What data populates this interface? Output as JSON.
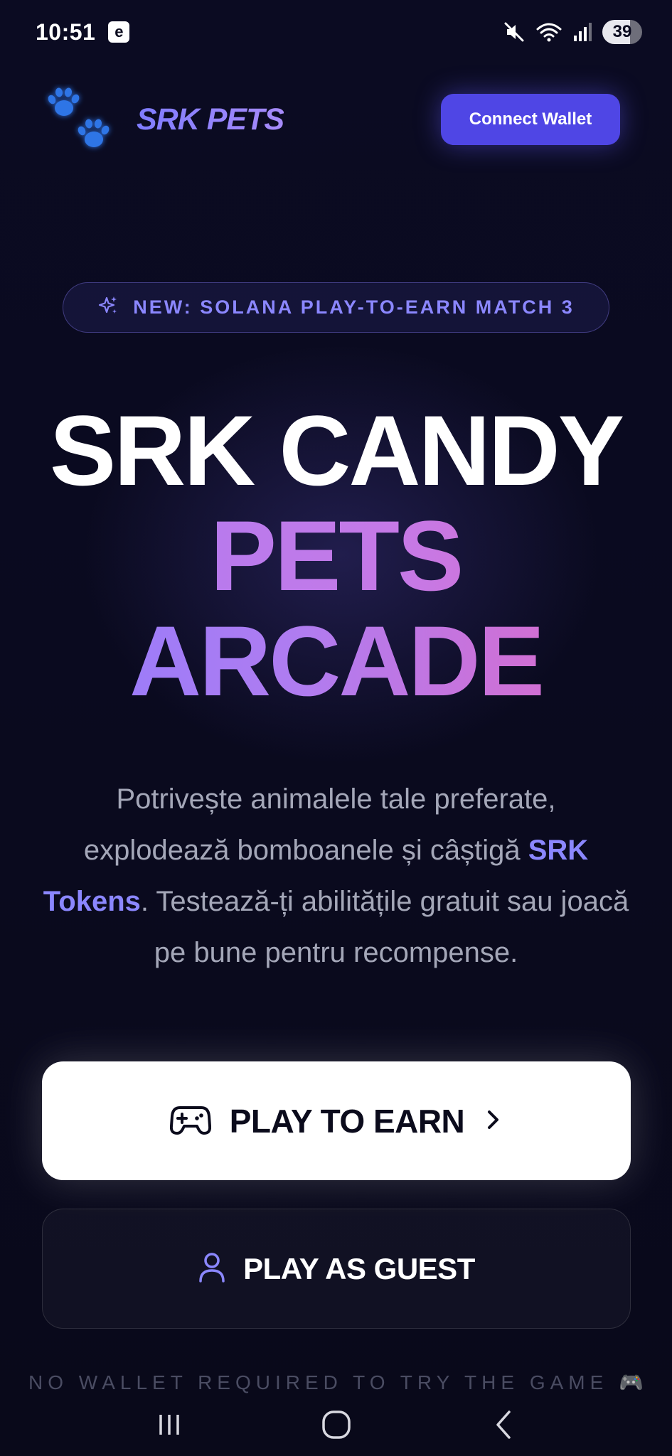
{
  "status_bar": {
    "time": "10:51",
    "notification_badge": "e",
    "battery": "39",
    "icons": [
      "mute-icon",
      "wifi-icon",
      "signal-icon"
    ]
  },
  "header": {
    "brand": "SRK PETS",
    "logo_icon": "paw-icon",
    "connect_label": "Connect Wallet"
  },
  "badge": {
    "icon": "sparkles-icon",
    "text": "NEW: SOLANA PLAY-TO-EARN MATCH 3"
  },
  "hero": {
    "line1": "SRK CANDY",
    "line2": "PETS",
    "line3": "ARCADE"
  },
  "description": {
    "part1": "Potrivește animalele tale preferate, explodează bomboanele și câștigă ",
    "highlight": "SRK Tokens",
    "part2": ". Testează-ți abilitățile gratuit sau joacă pe bune pentru recompense."
  },
  "actions": {
    "earn_label": "PLAY TO EARN",
    "earn_icon": "gamepad-icon",
    "earn_arrow": "chevron-right-icon",
    "guest_label": "PLAY AS GUEST",
    "guest_icon": "user-icon"
  },
  "footnote": {
    "text": "NO WALLET REQUIRED TO TRY THE GAME",
    "icon": "🎮"
  },
  "nav_bar": {
    "items": [
      "recents-icon",
      "home-icon",
      "back-icon"
    ]
  },
  "colors": {
    "background": "#0a0a1e",
    "accent": "#4f46e5",
    "highlight": "#8b87ff",
    "gradient_pink": "#e368c4"
  }
}
